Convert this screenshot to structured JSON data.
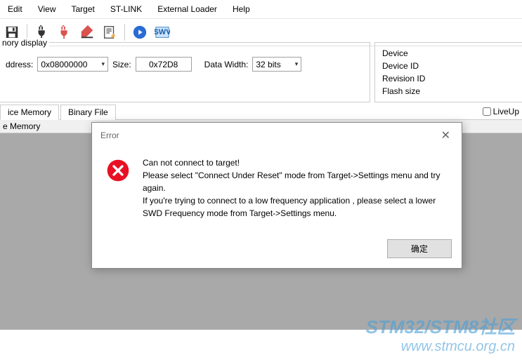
{
  "menu": [
    "Edit",
    "View",
    "Target",
    "ST-LINK",
    "External Loader",
    "Help"
  ],
  "memory_display": {
    "legend": "nory display",
    "address_label": "ddress:",
    "address_value": "0x08000000",
    "size_label": "Size:",
    "size_value": "0x72D8",
    "datawidth_label": "Data Width:",
    "datawidth_value": "32 bits"
  },
  "device_info": {
    "rows": [
      "Device",
      "Device ID",
      "Revision ID",
      "Flash size"
    ]
  },
  "tabs": {
    "tab1": "ice Memory",
    "tab2": "Binary File",
    "liveup": "LiveUp"
  },
  "subtab": "e Memory",
  "dialog": {
    "title": "Error",
    "line1": "Can not connect to target!",
    "line2": "Please select \"Connect Under Reset\" mode from Target->Settings menu and try again.",
    "line3": "If you're trying to connect to a low frequency application , please select a lower SWD Frequency mode from Target->Settings menu.",
    "ok": "确定"
  },
  "watermark": {
    "line1": "STM32/STM8社区",
    "line2": "www.stmcu.org.cn"
  }
}
